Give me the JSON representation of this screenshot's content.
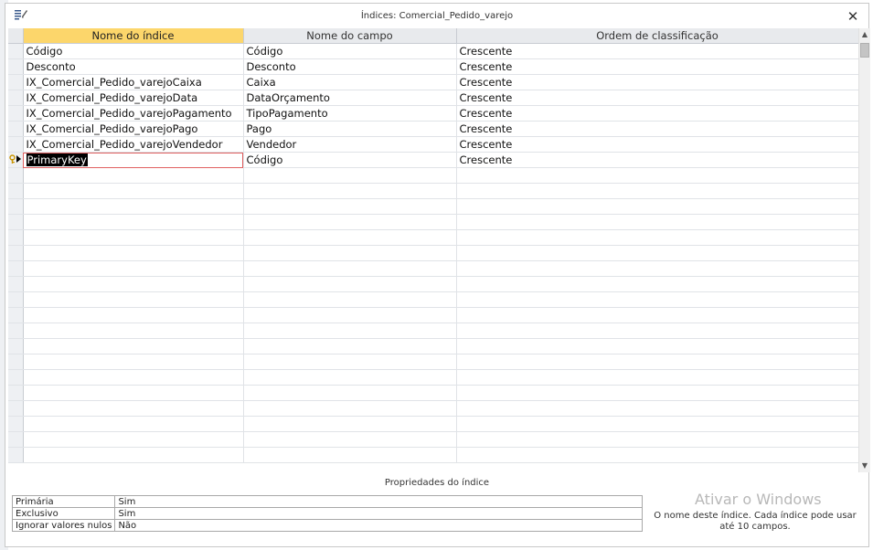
{
  "dialog": {
    "title": "Índices: Comercial_Pedido_varejo",
    "close_symbol": "✕"
  },
  "grid": {
    "columns": [
      "Nome do índice",
      "Nome do campo",
      "Ordem de classificação"
    ],
    "rows": [
      {
        "index_name": "Código",
        "field_name": "Código",
        "sort_order": "Crescente"
      },
      {
        "index_name": "Desconto",
        "field_name": "Desconto",
        "sort_order": "Crescente"
      },
      {
        "index_name": "IX_Comercial_Pedido_varejoCaixa",
        "field_name": "Caixa",
        "sort_order": "Crescente"
      },
      {
        "index_name": "IX_Comercial_Pedido_varejoData",
        "field_name": "DataOrçamento",
        "sort_order": "Crescente"
      },
      {
        "index_name": "IX_Comercial_Pedido_varejoPagamento",
        "field_name": "TipoPagamento",
        "sort_order": "Crescente"
      },
      {
        "index_name": "IX_Comercial_Pedido_varejoPago",
        "field_name": "Pago",
        "sort_order": "Crescente"
      },
      {
        "index_name": "IX_Comercial_Pedido_varejoVendedor",
        "field_name": "Vendedor",
        "sort_order": "Crescente"
      },
      {
        "index_name": "PrimaryKey",
        "field_name": "Código",
        "sort_order": "Crescente"
      }
    ],
    "current_row_icon": "key-arrow-icon"
  },
  "properties": {
    "heading": "Propriedades do índice",
    "items": [
      {
        "label": "Primária",
        "value": "Sim"
      },
      {
        "label": "Exclusivo",
        "value": "Sim"
      },
      {
        "label": "Ignorar valores nulos",
        "value": "Não"
      }
    ],
    "help_text": "O nome deste índice. Cada índice pode usar até 10 campos."
  },
  "watermark": "Ativar o Windows",
  "colors": {
    "active_header": "#fcd66b",
    "header": "#e8eaed",
    "selection_highlight": "#000000"
  }
}
